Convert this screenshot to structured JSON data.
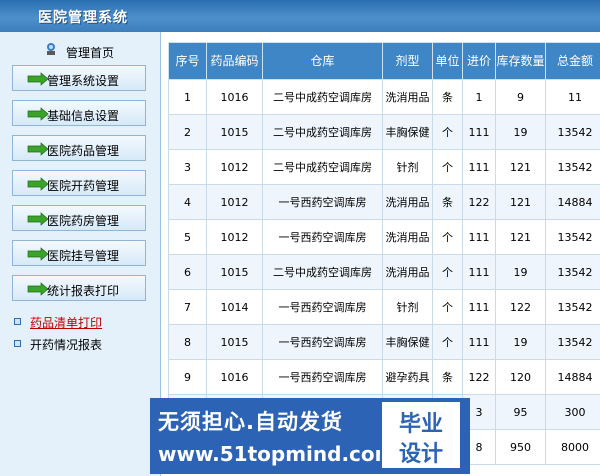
{
  "header": {
    "title": "医院管理系统"
  },
  "sidebar": {
    "home_label": "管理首页",
    "menu": [
      {
        "label": "管理系统设置"
      },
      {
        "label": "基础信息设置"
      },
      {
        "label": "医院药品管理"
      },
      {
        "label": "医院开药管理"
      },
      {
        "label": "医院药房管理"
      },
      {
        "label": "医院挂号管理"
      },
      {
        "label": "统计报表打印"
      }
    ],
    "sublinks": [
      {
        "label": "药品清单打印",
        "active": true
      },
      {
        "label": "开药情况报表",
        "active": false
      }
    ]
  },
  "table": {
    "columns": [
      "序号",
      "药品编码",
      "仓库",
      "剂型",
      "单位",
      "进价",
      "库存数量",
      "总金额"
    ],
    "rows": [
      [
        "1",
        "1016",
        "二号中成药空调库房",
        "洗消用品",
        "条",
        "1",
        "9",
        "11"
      ],
      [
        "2",
        "1015",
        "二号中成药空调库房",
        "丰胸保健",
        "个",
        "111",
        "19",
        "13542"
      ],
      [
        "3",
        "1012",
        "二号中成药空调库房",
        "针剂",
        "个",
        "111",
        "121",
        "13542"
      ],
      [
        "4",
        "1012",
        "一号西药空调库房",
        "洗消用品",
        "条",
        "122",
        "121",
        "14884"
      ],
      [
        "5",
        "1012",
        "一号西药空调库房",
        "洗消用品",
        "个",
        "111",
        "121",
        "13542"
      ],
      [
        "6",
        "1015",
        "二号中成药空调库房",
        "洗消用品",
        "个",
        "111",
        "19",
        "13542"
      ],
      [
        "7",
        "1014",
        "一号西药空调库房",
        "针剂",
        "个",
        "111",
        "122",
        "13542"
      ],
      [
        "8",
        "1015",
        "一号西药空调库房",
        "丰胸保健",
        "个",
        "111",
        "19",
        "13542"
      ],
      [
        "9",
        "1016",
        "一号西药空调库房",
        "避孕药具",
        "条",
        "122",
        "120",
        "14884"
      ],
      [
        "",
        "",
        "",
        "",
        "",
        "3",
        "95",
        "300"
      ],
      [
        "",
        "",
        "",
        "",
        "",
        "8",
        "950",
        "8000"
      ]
    ]
  },
  "ad": {
    "slogan": "无须担心.自动发货",
    "url": "www.51topmind.com",
    "box_line1": "毕业",
    "box_line2": "设计"
  },
  "colors": {
    "header_blue": "#3d7fbd",
    "table_header_blue": "#3f86c7",
    "sidebar_bg": "#e4f1fb",
    "active_link_red": "#c00000",
    "ad_blue": "#2c63b4"
  }
}
